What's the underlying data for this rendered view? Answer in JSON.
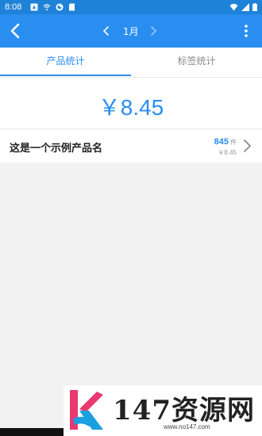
{
  "status_bar": {
    "time": "8:08"
  },
  "app_bar": {
    "month": "1月"
  },
  "tabs": [
    {
      "label": "产品统计",
      "active": true
    },
    {
      "label": "标签统计",
      "active": false
    }
  ],
  "summary": {
    "total": "￥8.45"
  },
  "products": [
    {
      "name": "这是一个示例产品名",
      "quantity": "845",
      "unit": "件",
      "price": "￥8.45"
    }
  ],
  "watermark": {
    "text": "147资源网",
    "url": "www.no147.com"
  },
  "colors": {
    "status_bar": "#1e82d9",
    "app_bar": "#2a8ef0",
    "accent": "#2a8ef0",
    "background": "#f2f2f2"
  }
}
